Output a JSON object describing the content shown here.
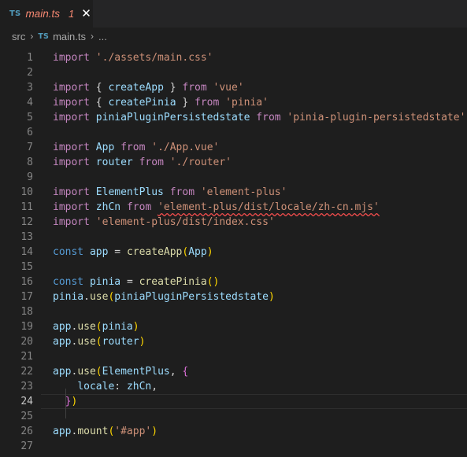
{
  "tab": {
    "badge": "TS",
    "filename": "main.ts",
    "problems": "1",
    "close": "✕"
  },
  "breadcrumb": {
    "folder": "src",
    "sep": "›",
    "badge": "TS",
    "file": "main.ts",
    "more": "..."
  },
  "active_line": 24,
  "lines": [
    {
      "n": "1",
      "tokens": [
        [
          "k",
          "import"
        ],
        [
          "",
          ""
        ],
        [
          "s",
          " './assets/main.css'"
        ]
      ]
    },
    {
      "n": "2",
      "tokens": []
    },
    {
      "n": "3",
      "tokens": [
        [
          "k",
          "import"
        ],
        [
          "v2",
          " { "
        ],
        [
          "v",
          "createApp"
        ],
        [
          "v2",
          " } "
        ],
        [
          "k",
          "from"
        ],
        [
          "s",
          " 'vue'"
        ]
      ]
    },
    {
      "n": "4",
      "tokens": [
        [
          "k",
          "import"
        ],
        [
          "v2",
          " { "
        ],
        [
          "v",
          "createPinia"
        ],
        [
          "v2",
          " } "
        ],
        [
          "k",
          "from"
        ],
        [
          "s",
          " 'pinia'"
        ]
      ]
    },
    {
      "n": "5",
      "tokens": [
        [
          "k",
          "import"
        ],
        [
          "v",
          " piniaPluginPersistedstate "
        ],
        [
          "k",
          "from"
        ],
        [
          "s",
          " 'pinia-plugin-persistedstate'"
        ]
      ]
    },
    {
      "n": "6",
      "tokens": []
    },
    {
      "n": "7",
      "tokens": [
        [
          "k",
          "import"
        ],
        [
          "v",
          " App "
        ],
        [
          "k",
          "from"
        ],
        [
          "s",
          " './App.vue'"
        ]
      ]
    },
    {
      "n": "8",
      "tokens": [
        [
          "k",
          "import"
        ],
        [
          "v",
          " router "
        ],
        [
          "k",
          "from"
        ],
        [
          "s",
          " './router'"
        ]
      ]
    },
    {
      "n": "9",
      "tokens": []
    },
    {
      "n": "10",
      "tokens": [
        [
          "k",
          "import"
        ],
        [
          "v",
          " ElementPlus "
        ],
        [
          "k",
          "from"
        ],
        [
          "s",
          " 'element-plus'"
        ]
      ]
    },
    {
      "n": "11",
      "tokens": [
        [
          "k",
          "import"
        ],
        [
          "v",
          " zhCn "
        ],
        [
          "k",
          "from"
        ],
        [
          "v2",
          " "
        ],
        [
          "s err",
          "'element-plus/dist/locale/zh-cn.mjs'"
        ]
      ]
    },
    {
      "n": "12",
      "tokens": [
        [
          "k",
          "import"
        ],
        [
          "s",
          " 'element-plus/dist/index.css'"
        ]
      ]
    },
    {
      "n": "13",
      "tokens": []
    },
    {
      "n": "14",
      "tokens": [
        [
          "kw",
          "const"
        ],
        [
          "v",
          " app "
        ],
        [
          "v2",
          "= "
        ],
        [
          "fn",
          "createApp"
        ],
        [
          "p1",
          "("
        ],
        [
          "v",
          "App"
        ],
        [
          "p1",
          ")"
        ]
      ]
    },
    {
      "n": "15",
      "tokens": []
    },
    {
      "n": "16",
      "tokens": [
        [
          "kw",
          "const"
        ],
        [
          "v",
          " pinia "
        ],
        [
          "v2",
          "= "
        ],
        [
          "fn",
          "createPinia"
        ],
        [
          "p1",
          "()"
        ]
      ]
    },
    {
      "n": "17",
      "tokens": [
        [
          "v",
          "pinia"
        ],
        [
          "v2",
          "."
        ],
        [
          "fn",
          "use"
        ],
        [
          "p1",
          "("
        ],
        [
          "v",
          "piniaPluginPersistedstate"
        ],
        [
          "p1",
          ")"
        ]
      ]
    },
    {
      "n": "18",
      "tokens": []
    },
    {
      "n": "19",
      "tokens": [
        [
          "v",
          "app"
        ],
        [
          "v2",
          "."
        ],
        [
          "fn",
          "use"
        ],
        [
          "p1",
          "("
        ],
        [
          "v",
          "pinia"
        ],
        [
          "p1",
          ")"
        ]
      ]
    },
    {
      "n": "20",
      "tokens": [
        [
          "v",
          "app"
        ],
        [
          "v2",
          "."
        ],
        [
          "fn",
          "use"
        ],
        [
          "p1",
          "("
        ],
        [
          "v",
          "router"
        ],
        [
          "p1",
          ")"
        ]
      ]
    },
    {
      "n": "21",
      "tokens": []
    },
    {
      "n": "22",
      "tokens": [
        [
          "v",
          "app"
        ],
        [
          "v2",
          "."
        ],
        [
          "fn",
          "use"
        ],
        [
          "p1",
          "("
        ],
        [
          "v",
          "ElementPlus"
        ],
        [
          "v2",
          ", "
        ],
        [
          "p2",
          "{"
        ]
      ]
    },
    {
      "n": "23",
      "tokens": [
        [
          "v2",
          "    "
        ],
        [
          "v",
          "locale"
        ],
        [
          "v2",
          ": "
        ],
        [
          "v",
          "zhCn"
        ],
        [
          "v2",
          ","
        ]
      ]
    },
    {
      "n": "24",
      "tokens": [
        [
          "v2",
          "  "
        ],
        [
          "p2",
          "}"
        ],
        [
          "p1",
          ")"
        ]
      ]
    },
    {
      "n": "25",
      "tokens": []
    },
    {
      "n": "26",
      "tokens": [
        [
          "v",
          "app"
        ],
        [
          "v2",
          "."
        ],
        [
          "fn",
          "mount"
        ],
        [
          "p1",
          "("
        ],
        [
          "s",
          "'#app'"
        ],
        [
          "p1",
          ")"
        ]
      ]
    },
    {
      "n": "27",
      "tokens": []
    }
  ]
}
